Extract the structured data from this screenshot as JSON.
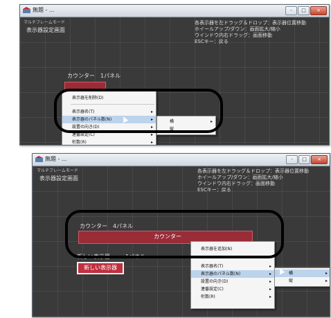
{
  "window1": {
    "title": "無題 - ...",
    "controls": [
      "-",
      "□",
      "×"
    ],
    "mode": "マルチフレームモード",
    "heading": "表示器設定画面",
    "help": [
      "各表示器を左ドラッグ＆ドロップ：表示器位置移動",
      "ホイールアップ/ダウン：画面拡大/縮小",
      "ウインドウ内右ドラッグ：画面移動",
      "ESCキー：戻る"
    ],
    "panel_label": "カウンター　1パネル",
    "menu": [
      "表示器を削除(D)",
      "表示器名(T)",
      "表示器のパネル数(N)",
      "設置の向き(D)",
      "連番設定(C)",
      "桁数(R)"
    ],
    "submenu": [
      "横",
      "縦"
    ]
  },
  "window2": {
    "title": "無題 - ...",
    "controls": [
      "-",
      "□",
      "×"
    ],
    "mode": "マルチフレームモード",
    "heading": "表示器設定画面",
    "help": [
      "各表示器を左ドラッグ＆ドロップ：表示器位置移動",
      "ホイールアップ/ダウン：画面拡大/縮小",
      "ウインドウ内右ドラッグ：画面移動",
      "ESCキー：戻る"
    ],
    "panel_label": "カウンター　4パネル",
    "panel_center": "カウンター",
    "new_label": "新しい表示器",
    "new_label_right": "1パネル",
    "new_box": "新しい表示器",
    "menu": [
      "表示器を追加(N)",
      "表示器名(T)",
      "表示器のパネル数(N)",
      "設置の向き(D)",
      "連番設定(C)",
      "桁数(R)"
    ],
    "submenu": [
      "横",
      "縦"
    ]
  },
  "colors": {
    "background": "#3a3a3a",
    "panel": "#9a2c38",
    "menu_highlight": "#bcd3ec"
  }
}
